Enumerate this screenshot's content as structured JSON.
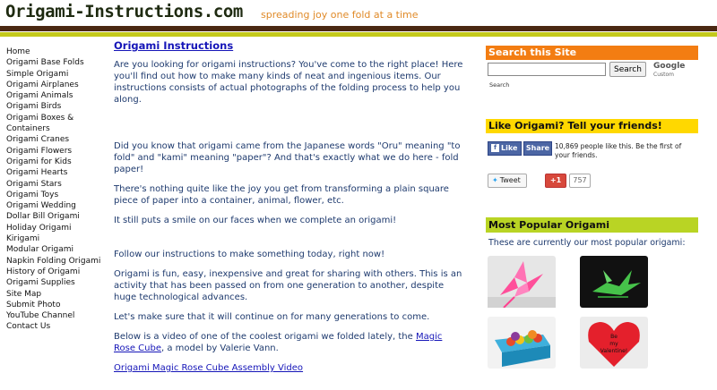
{
  "header": {
    "site_title": "Origami-Instructions.com",
    "tagline": "spreading joy one fold at a time"
  },
  "nav": {
    "items": [
      "Home",
      "Origami Base Folds",
      "Simple Origami",
      "Origami Airplanes",
      "Origami Animals",
      "Origami Birds",
      "Origami Boxes &",
      "Containers",
      "Origami Cranes",
      "Origami Flowers",
      "Origami for Kids",
      "Origami Hearts",
      "Origami Stars",
      "Origami Toys",
      "Origami Wedding",
      "Dollar Bill Origami",
      "Holiday Origami",
      "Kirigami",
      "Modular Origami",
      "Napkin Folding Origami",
      "History of Origami",
      "Origami Supplies",
      "Site Map",
      "Submit Photo",
      "YouTube Channel",
      "Contact Us"
    ]
  },
  "main": {
    "heading": "Origami Instructions",
    "p1": "Are you looking for origami instructions?  You've come to the right place! Here you'll find out how to make many kinds of neat and ingenious items. Our instructions consists of actual photographs of the folding process to help you along.",
    "p2": "Did you know that origami came from the Japanese words \"Oru\" meaning \"to fold\" and \"kami\" meaning \"paper\"? And that's exactly what we do here - fold paper!",
    "p3": "There's nothing quite like the joy you get from transforming a plain square piece of paper into a container, animal, flower, etc.",
    "p4": "It still puts a smile on our faces when we complete an origami!",
    "p5": "Follow our instructions to make something today, right now!",
    "p6": "Origami is fun, easy, inexpensive and great for sharing with others.  This is an activity that has been passed on from one generation to another, despite huge technological advances.",
    "p7": "Let's make sure that it will continue on for many generations to come.",
    "p8_before": "Below is a video of one of the coolest origami we folded lately, the ",
    "p8_link": "Magic Rose Cube",
    "p8_after": ", a model by Valerie Vann.",
    "video_link": "Origami Magic Rose Cube Assembly Video"
  },
  "sidebar": {
    "search_heading": "Search this Site",
    "search_button": "Search",
    "search_value": "",
    "search_footer": "Search",
    "google": "Google",
    "custom": "Custom",
    "friends_heading": "Like Origami? Tell your friends!",
    "like_label": "Like",
    "share_label": "Share",
    "like_text": "10,869 people like this. Be the first of your friends.",
    "tweet_label": "Tweet",
    "gplus_label": "+1",
    "gplus_count": "757",
    "popular_heading": "Most Popular Origami",
    "popular_text": "These are currently our most popular origami:",
    "heart_text": "Be my Valentine!"
  },
  "colors": {
    "header_brown": "#4a2812",
    "header_green": "#c3c91b",
    "tagline": "#e08a28",
    "search_head": "#f37d12",
    "friends_head": "#ffd800",
    "popular_head": "#b9d424",
    "link": "#1515b8",
    "body_text": "#1e3a6e"
  }
}
